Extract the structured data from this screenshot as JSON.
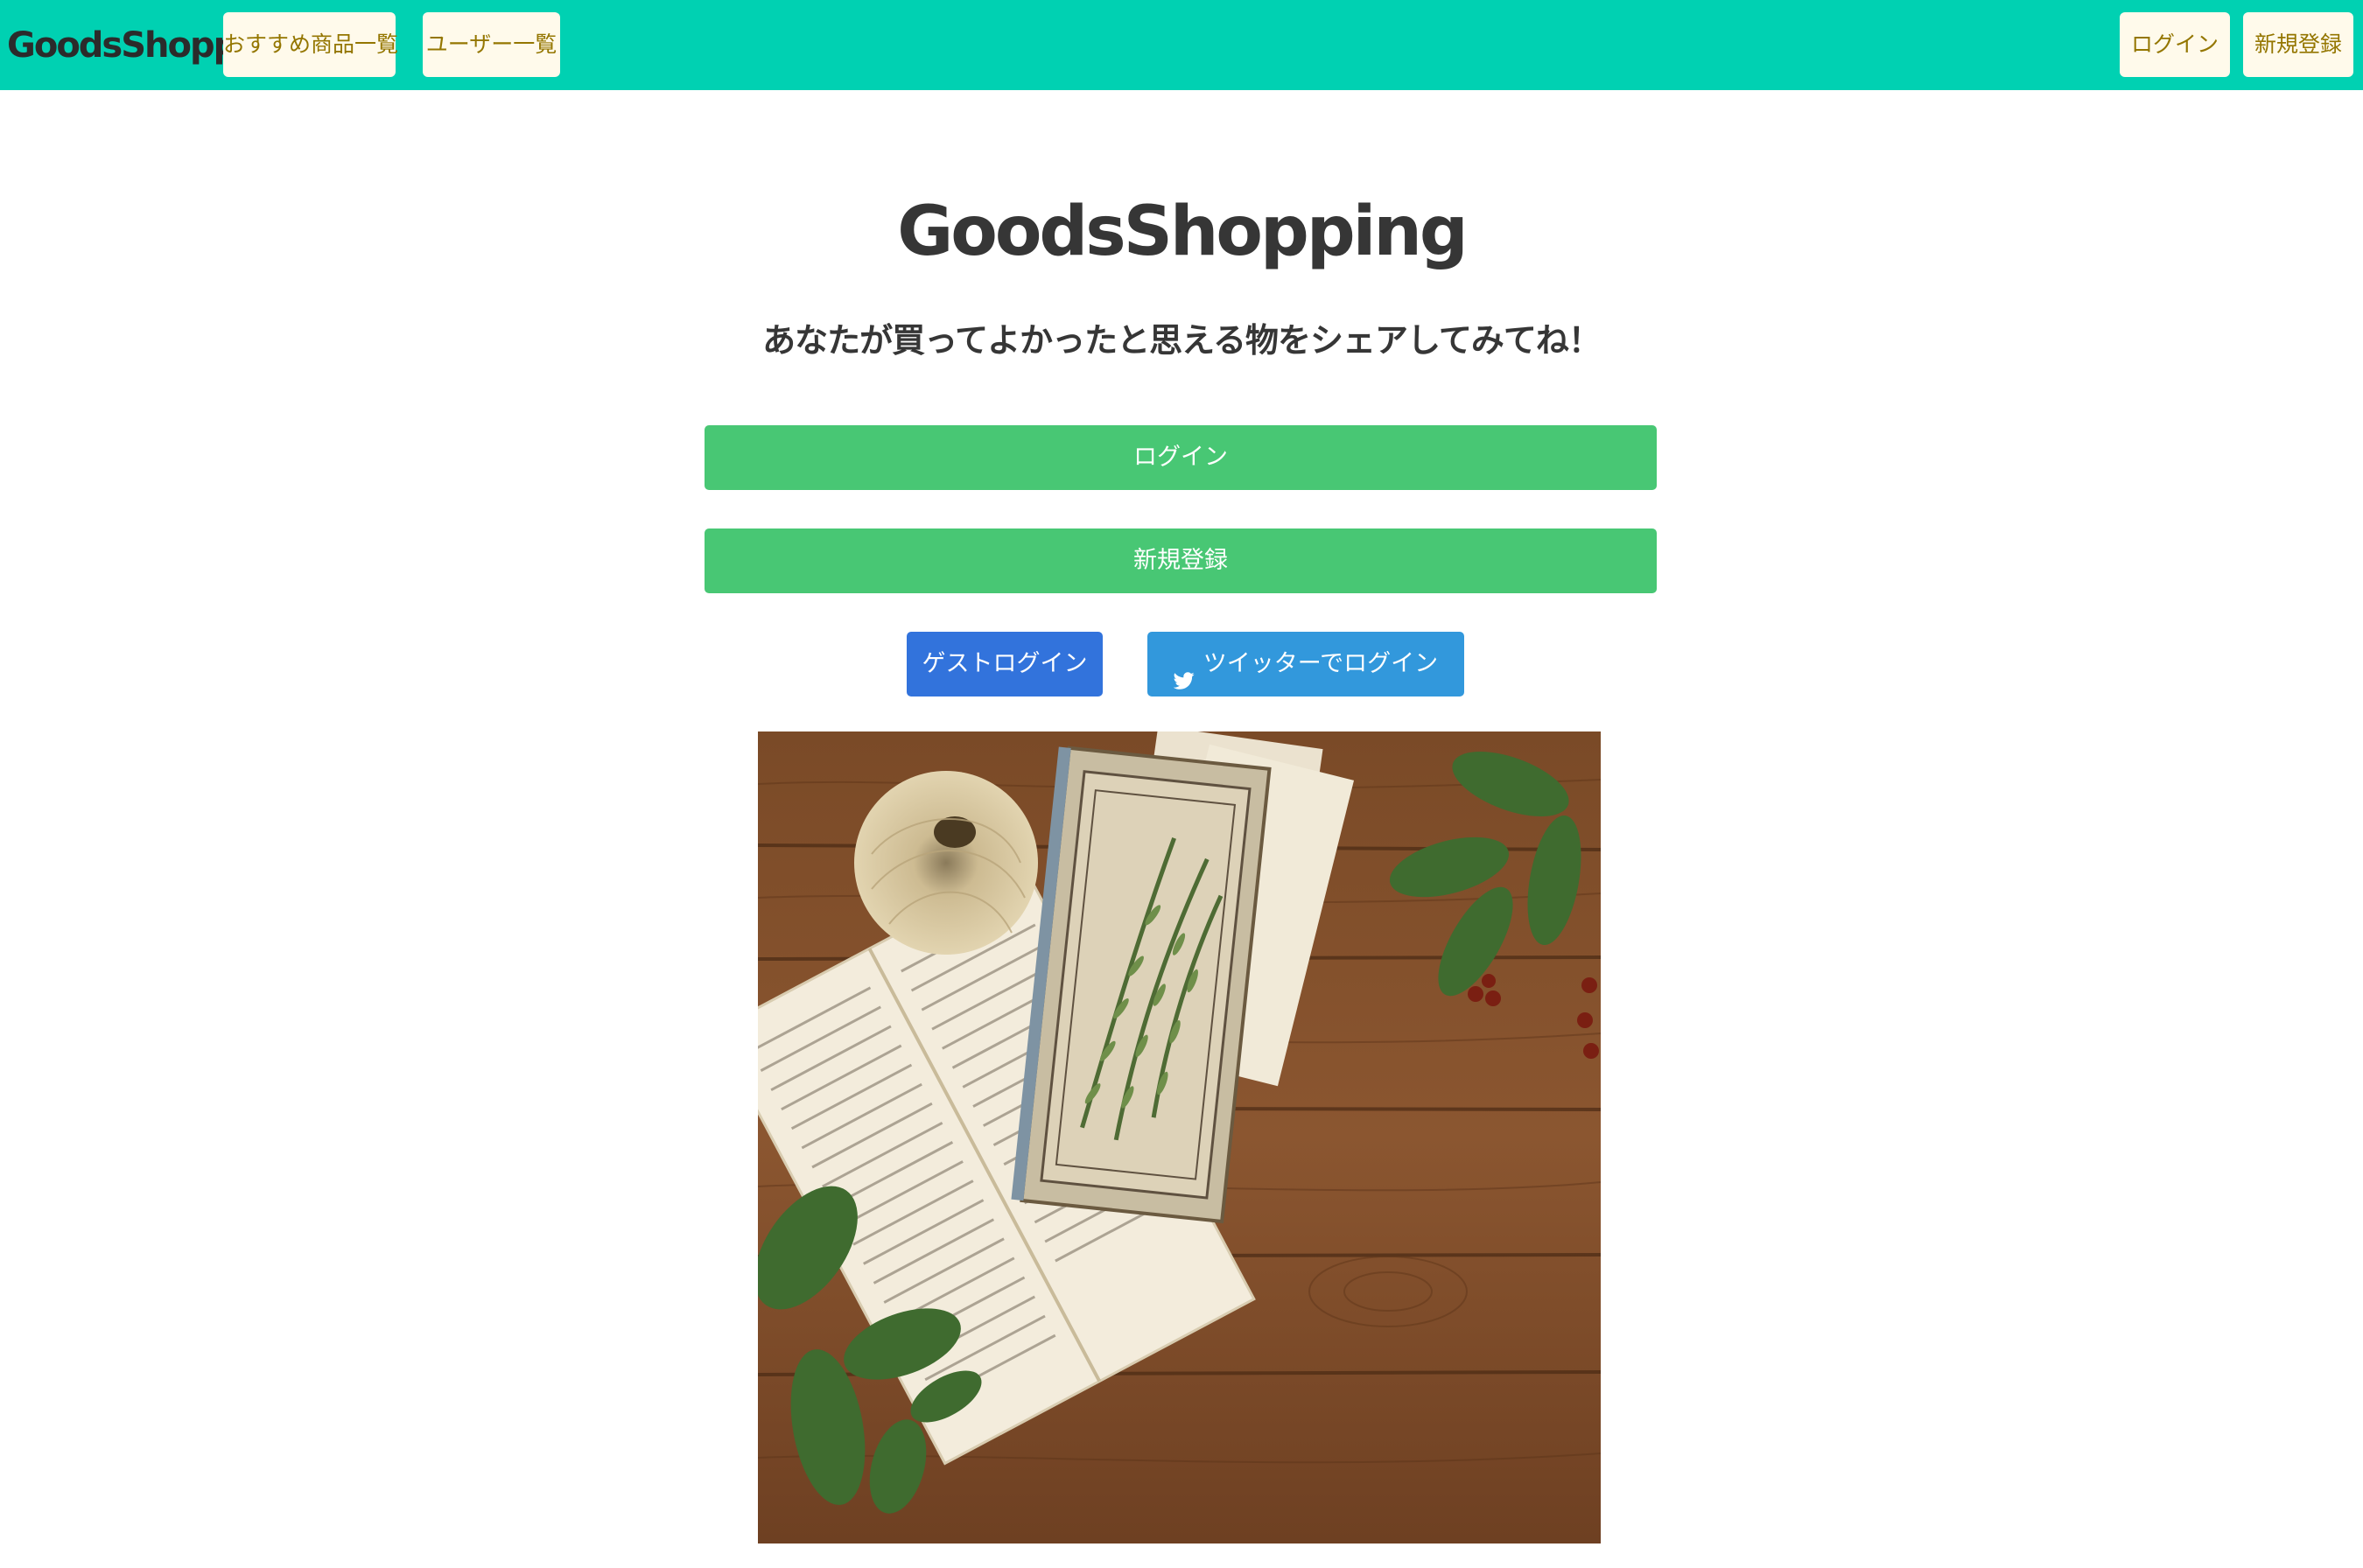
{
  "navbar": {
    "brand": "GoodsShopping",
    "recommended": "おすすめ商品一覧",
    "users": "ユーザー一覧",
    "login": "ログイン",
    "signup": "新規登録",
    "bg_color": "#00d1b2"
  },
  "hero": {
    "title": "GoodsShopping",
    "subtitle": "あなたが買ってよかったと思える物をシェアしてみてね！",
    "login_button": "ログイン",
    "signup_button": "新規登録",
    "guest_login_button": "ゲストログイン",
    "twitter_login_button": "ツイッターでログイン"
  },
  "colors": {
    "primary_green": "#48c774",
    "guest_blue": "#3273dc",
    "twitter_blue": "#3298dc",
    "nav_button_bg": "#fffaeb"
  },
  "icons": {
    "twitter": "twitter-bird-icon"
  },
  "image": {
    "subject": "vintage-books-herbs-on-wood"
  }
}
